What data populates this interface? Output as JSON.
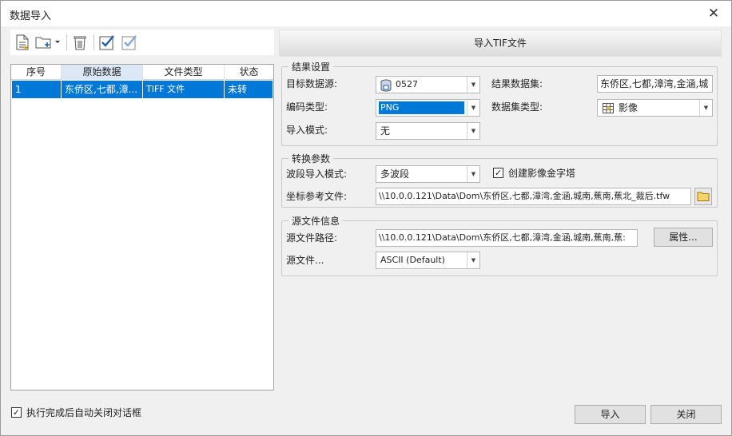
{
  "window": {
    "title": "数据导入",
    "close_icon": "✕"
  },
  "toolbar": {
    "icons": [
      "new-file-icon",
      "add-folder-icon",
      "dropdown-arrow-icon",
      "delete-icon",
      "select-all-icon",
      "invert-select-icon"
    ]
  },
  "table": {
    "headers": [
      "序号",
      "原始数据",
      "文件类型",
      "状态"
    ],
    "rows": [
      {
        "index": "1",
        "source": "东侨区,七都,漳...",
        "type": "TIFF 文件",
        "status": "未转"
      }
    ]
  },
  "tab": {
    "label": "导入TIF文件"
  },
  "result_settings": {
    "legend": "结果设置",
    "target_datasource_label": "目标数据源:",
    "target_datasource_value": "0527",
    "result_dataset_label": "结果数据集:",
    "result_dataset_value": "东侨区,七都,漳湾,金涵,城",
    "encoding_label": "编码类型:",
    "encoding_value": "PNG",
    "dataset_type_label": "数据集类型:",
    "dataset_type_value": "影像",
    "import_mode_label": "导入模式:",
    "import_mode_value": "无"
  },
  "conversion": {
    "legend": "转换参数",
    "band_mode_label": "波段导入模式:",
    "band_mode_value": "多波段",
    "pyramid_label": "创建影像金字塔",
    "pyramid_checked": "✓",
    "coord_file_label": "坐标参考文件:",
    "coord_file_value": "\\\\10.0.0.121\\Data\\Dom\\东侨区,七都,漳湾,金涵,城南,蕉南,蕉北_裁后.tfw"
  },
  "source_info": {
    "legend": "源文件信息",
    "path_label": "源文件路径:",
    "path_value": "\\\\10.0.0.121\\Data\\Dom\\东侨区,七都,漳湾,金涵,城南,蕉南,蕉:",
    "properties_button": "属性...",
    "charset_label": "源文件...",
    "charset_value": "ASCII (Default)"
  },
  "footer": {
    "auto_close_label": "执行完成后自动关闭对话框",
    "auto_close_checked": "✓",
    "import_button": "导入",
    "close_button": "关闭"
  },
  "colors": {
    "selection": "#0078d7",
    "background": "#f0f0f0",
    "icon_blue": "#1a5fb4"
  }
}
